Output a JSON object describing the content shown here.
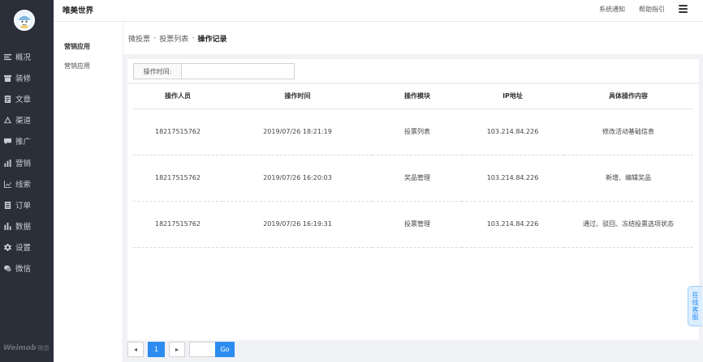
{
  "app": {
    "title": "唯美世界"
  },
  "header": {
    "links": [
      "系统通知",
      "帮助指引"
    ]
  },
  "sidebar": {
    "items": [
      {
        "label": "概况",
        "icon": "list-icon"
      },
      {
        "label": "装修",
        "icon": "shop-icon"
      },
      {
        "label": "文章",
        "icon": "document-icon"
      },
      {
        "label": "渠道",
        "icon": "channel-icon"
      },
      {
        "label": "推广",
        "icon": "chat-icon"
      },
      {
        "label": "营销",
        "icon": "bar-chart-icon"
      },
      {
        "label": "线索",
        "icon": "line-chart-icon"
      },
      {
        "label": "订单",
        "icon": "order-icon"
      },
      {
        "label": "数据",
        "icon": "data-icon"
      },
      {
        "label": "设置",
        "icon": "gear-icon"
      },
      {
        "label": "微信",
        "icon": "wechat-icon"
      }
    ],
    "brand": "Weimob",
    "brand_cn": "微盟"
  },
  "subnav": {
    "title": "营销应用",
    "items": [
      "营销应用"
    ]
  },
  "breadcrumb": {
    "items": [
      "微投票",
      "投票列表"
    ],
    "current": "操作记录",
    "separator": "-"
  },
  "filter": {
    "label": "操作时间:",
    "value": "",
    "placeholder": ""
  },
  "table": {
    "columns": [
      "操作人员",
      "操作时间",
      "操作模块",
      "IP地址",
      "具体操作内容"
    ],
    "rows": [
      [
        "18217515762",
        "2019/07/26 18:21:19",
        "投票列表",
        "103.214.84.226",
        "修改活动基础信息"
      ],
      [
        "18217515762",
        "2019/07/26 16:20:03",
        "奖品管理",
        "103.214.84.226",
        "新增、编辑奖品"
      ],
      [
        "18217515762",
        "2019/07/26 16:19:31",
        "投票管理",
        "103.214.84.226",
        "通过、驳回、冻结投票选项状态"
      ]
    ]
  },
  "pagination": {
    "prev": "◂",
    "current_page": "1",
    "next": "▸",
    "jump_value": "",
    "go_label": "Go"
  },
  "float_service": {
    "label": "在线客服"
  },
  "colors": {
    "sidebar_bg": "#2b2f3a",
    "accent": "#2d8cf0",
    "page_bg": "#f1f2f6"
  }
}
